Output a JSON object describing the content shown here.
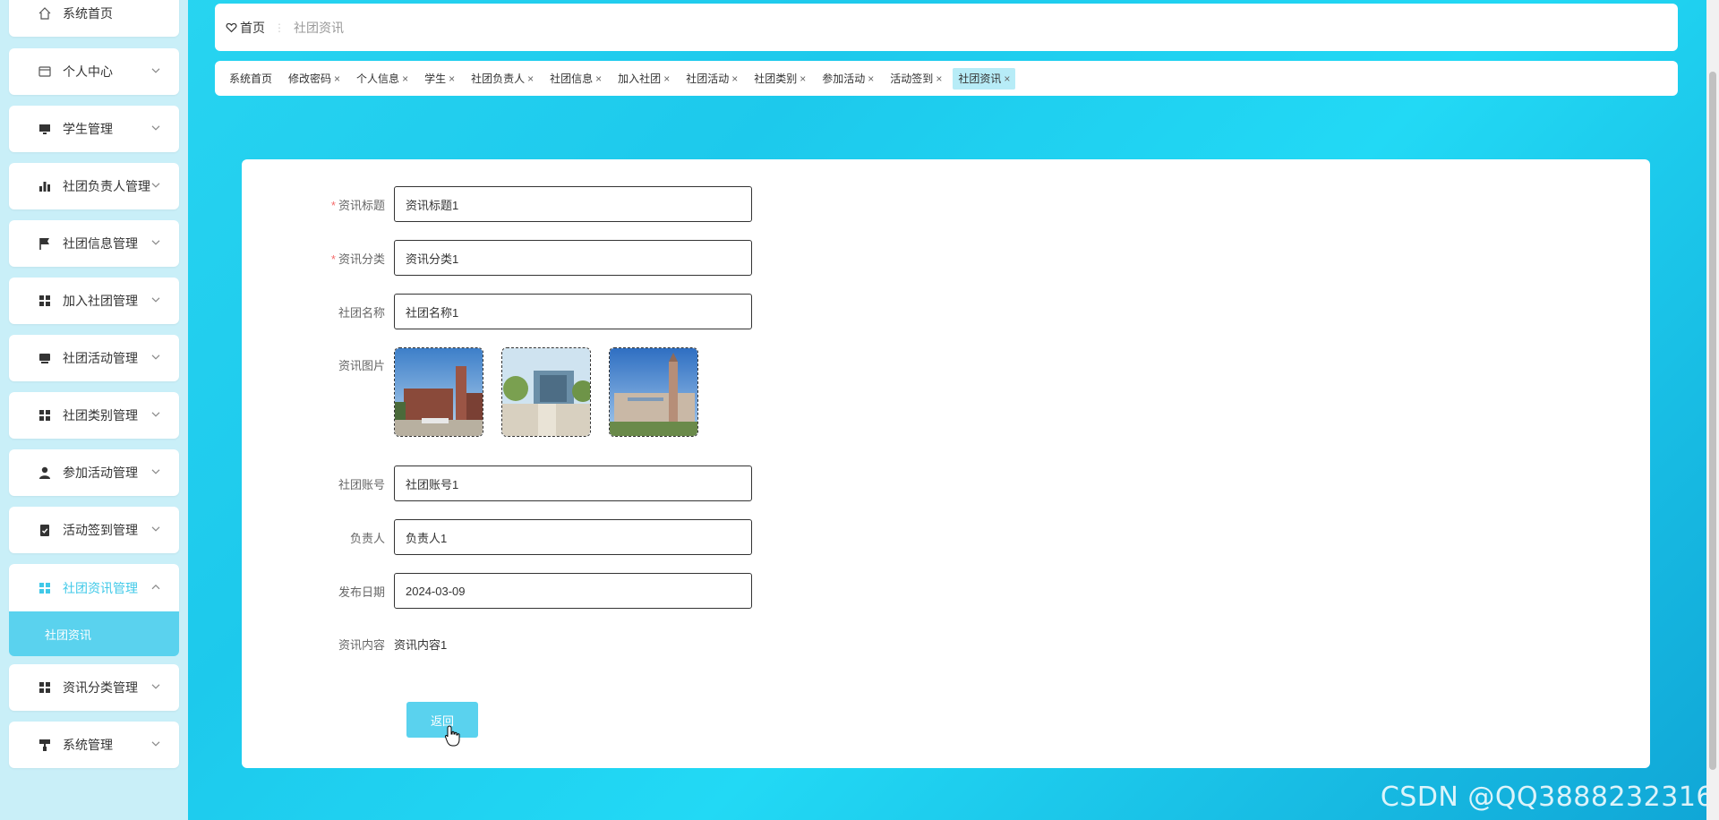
{
  "sidebar": {
    "items": [
      {
        "label": "系统首页",
        "icon": "home-icon"
      },
      {
        "label": "个人中心",
        "icon": "id-card-icon"
      },
      {
        "label": "学生管理",
        "icon": "monitor-icon"
      },
      {
        "label": "社团负责人管理",
        "icon": "bar-chart-icon"
      },
      {
        "label": "社团信息管理",
        "icon": "flag-icon"
      },
      {
        "label": "加入社团管理",
        "icon": "grid-icon"
      },
      {
        "label": "社团活动管理",
        "icon": "tray-icon"
      },
      {
        "label": "社团类别管理",
        "icon": "grid-icon"
      },
      {
        "label": "参加活动管理",
        "icon": "user-icon"
      },
      {
        "label": "活动签到管理",
        "icon": "clipboard-check-icon"
      },
      {
        "label": "社团资讯管理",
        "icon": "grid-icon"
      },
      {
        "label": "资讯分类管理",
        "icon": "grid-icon"
      },
      {
        "label": "系统管理",
        "icon": "paint-roller-icon"
      }
    ],
    "submenu_label": "社团资讯",
    "active_color": "#40c9e8"
  },
  "breadcrumb": {
    "home": "首页",
    "current": "社团资讯"
  },
  "tabs": [
    {
      "label": "系统首页",
      "closable": false
    },
    {
      "label": "修改密码",
      "closable": true
    },
    {
      "label": "个人信息",
      "closable": true
    },
    {
      "label": "学生",
      "closable": true
    },
    {
      "label": "社团负责人",
      "closable": true
    },
    {
      "label": "社团信息",
      "closable": true
    },
    {
      "label": "加入社团",
      "closable": true
    },
    {
      "label": "社团活动",
      "closable": true
    },
    {
      "label": "社团类别",
      "closable": true
    },
    {
      "label": "参加活动",
      "closable": true
    },
    {
      "label": "活动签到",
      "closable": true
    },
    {
      "label": "社团资讯",
      "closable": true,
      "active": true
    }
  ],
  "form": {
    "title_label": "资讯标题",
    "title_value": "资讯标题1",
    "category_label": "资讯分类",
    "category_value": "资讯分类1",
    "club_name_label": "社团名称",
    "club_name_value": "社团名称1",
    "images_label": "资讯图片",
    "club_account_label": "社团账号",
    "club_account_value": "社团账号1",
    "leader_label": "负责人",
    "leader_value": "负责人1",
    "date_label": "发布日期",
    "date_value": "2024-03-09",
    "content_label": "资讯内容",
    "content_value": "资讯内容1",
    "back_button": "返回"
  },
  "watermark": "CSDN @QQ3888232316"
}
